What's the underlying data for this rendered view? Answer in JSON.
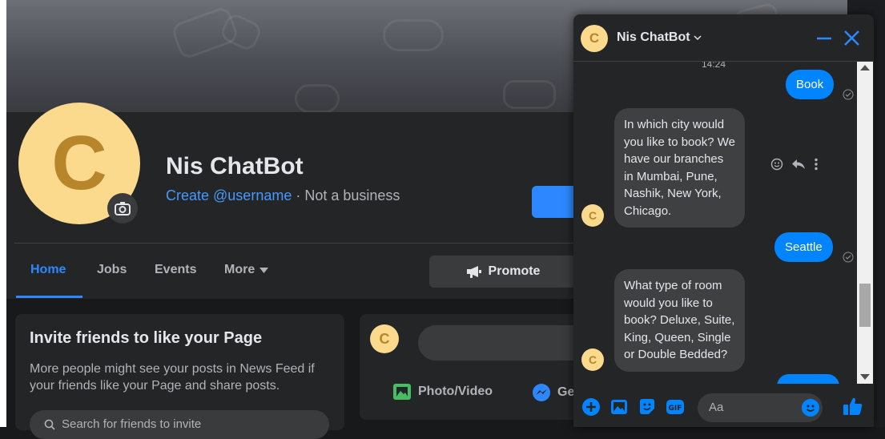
{
  "page": {
    "name": "Nis ChatBot",
    "avatar_letter": "C",
    "username_link": "Create @username",
    "separator": " · ",
    "category": "Not a business"
  },
  "nav": {
    "items": [
      "Home",
      "Jobs",
      "Events",
      "More"
    ],
    "active": "Home",
    "promote_label": "Promote"
  },
  "invite": {
    "title": "Invite friends to like your Page",
    "description": "More people might see your posts in News Feed if your friends like your Page and share posts.",
    "search_placeholder": "Search for friends to invite"
  },
  "composer": {
    "avatar_letter": "C",
    "actions": [
      "Photo/Video",
      "Ge"
    ]
  },
  "chat": {
    "title": "Nis ChatBot",
    "avatar_letter": "C",
    "timestamp": "14:24",
    "messages": [
      {
        "from": "me",
        "text": "Book"
      },
      {
        "from": "bot",
        "text": "In which city would you like to book? We have our branches in Mumbai, Pune, Nashik, New York, Chicago."
      },
      {
        "from": "me",
        "text": "Seattle"
      },
      {
        "from": "bot",
        "text": "What type of room would you like to book? Deluxe, Suite, King, Queen, Single or Double Bedded?"
      }
    ],
    "input_placeholder": "Aa",
    "accent": "#0084ff"
  },
  "colors": {
    "brand_blue": "#2d88ff",
    "avatar_bg": "#fbd98d",
    "avatar_fg": "#b8862a"
  }
}
